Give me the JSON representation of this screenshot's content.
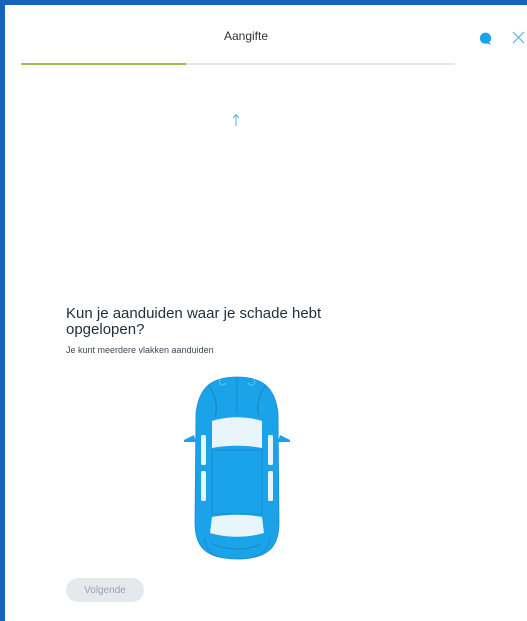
{
  "header": {
    "title": "Aangifte",
    "chat_icon": "chat-bubble-icon",
    "close_icon": "close-icon"
  },
  "progress": {
    "fraction": 0.38,
    "fill_color": "#9bbf4c"
  },
  "scroll_hint_icon": "arrow-up-icon",
  "question": {
    "title": "Kun je aanduiden waar je schade hebt opgelopen?",
    "hint": "Je kunt meerdere vlakken aanduiden"
  },
  "car_diagram": {
    "icon": "car-top-view-icon",
    "body_color": "#1aa3e8",
    "window_color": "#e8f6fb"
  },
  "footer": {
    "next_label": "Volgende",
    "next_enabled": false
  },
  "colors": {
    "accent": "#1aa3e8",
    "frame": "#1565c0"
  }
}
